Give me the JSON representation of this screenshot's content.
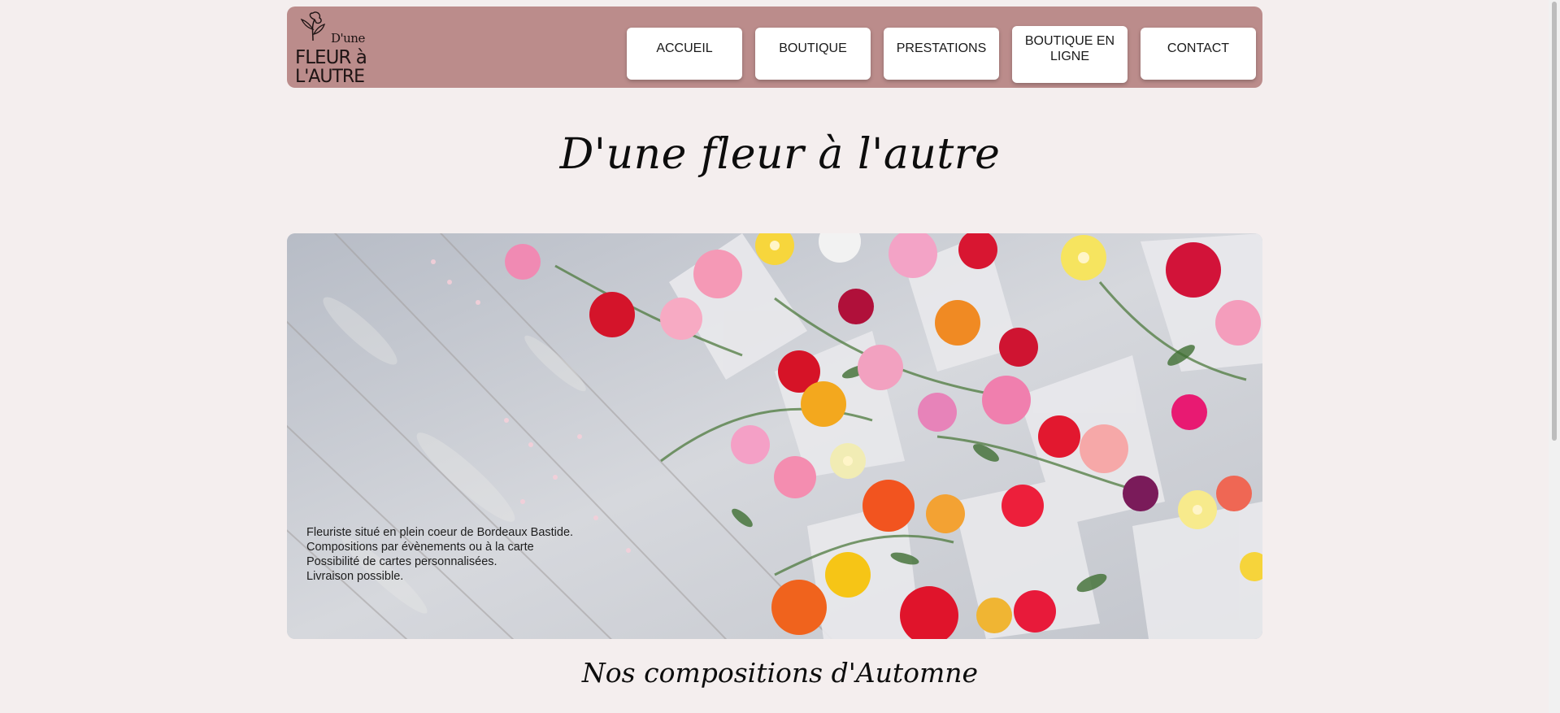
{
  "logo": {
    "line1": "D'une",
    "line2": "FLEUR à",
    "line3": "L'AUTRE"
  },
  "nav": [
    {
      "label": "ACCUEIL"
    },
    {
      "label": "BOUTIQUE"
    },
    {
      "label": "PRESTATIONS"
    },
    {
      "label": "BOUTIQUE EN LIGNE"
    },
    {
      "label": "CONTACT"
    }
  ],
  "page_title": "D'une fleur à l'autre",
  "hero": {
    "lines": [
      "Fleuriste situé en plein coeur de Bordeaux Bastide.",
      "Compositions par évènements ou à la carte",
      "Possibilité de cartes personnalisées.",
      "Livraison possible."
    ]
  },
  "section_title": "Nos compositions d'Automne",
  "colors": {
    "header_bg": "#bb8c8b",
    "page_bg": "#f4eeee",
    "button_bg": "#ffffff"
  }
}
